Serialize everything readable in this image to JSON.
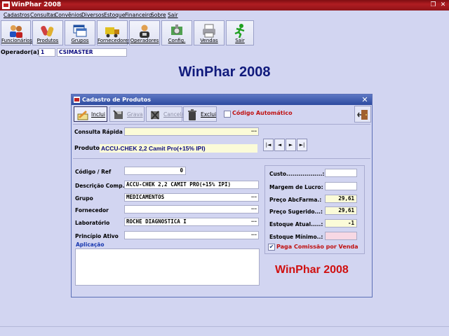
{
  "window": {
    "title": "WinPhar 2008"
  },
  "menu": [
    "Cadastros",
    "Consultas",
    "Convênios",
    "Diversos",
    "Estoque",
    "Financeiro",
    "Sobre",
    "Sair"
  ],
  "toolbar": [
    "Funcionários",
    "Produtos",
    "Grupos",
    "Fornecedores",
    "Operadores",
    "Config.",
    "Vendas",
    "Sair"
  ],
  "operator": {
    "label": "Operador(a):",
    "id": "1",
    "name": "CSIMASTER"
  },
  "heading": "WinPhar 2008",
  "dialog": {
    "title": "Cadastro de Produtos",
    "buttons": {
      "inclui": "Inclui",
      "grava": "Grava",
      "cancela": "Cancela",
      "exclui": "Exclui"
    },
    "auto_code_label": "Código Automático",
    "consulta_label": "Consulta Rápida",
    "consulta_value": "",
    "produto_label": "Produto",
    "produto_value": "ACCU-CHEK 2,2 Camit Pro(+15% IPI)",
    "nav": [
      "|◄",
      "◄",
      "►",
      "►|"
    ],
    "fields": {
      "codigo": {
        "label": "Código / Ref",
        "value": "0"
      },
      "descricao": {
        "label": "Descrição Comp.",
        "value": "ACCU-CHEK 2,2 CAMIT PRO(+15% IPI)"
      },
      "grupo": {
        "label": "Grupo",
        "value": "MEDICAMENTOS"
      },
      "fornecedor": {
        "label": "Fornecedor",
        "value": ""
      },
      "laboratorio": {
        "label": "Laboratório",
        "value": "ROCHE DIAGNOSTICA I"
      },
      "principio": {
        "label": "Princípio Ativo",
        "value": ""
      }
    },
    "aplicacao_label": "Aplicação",
    "aplicacao_value": "",
    "prices": {
      "custo": {
        "label": "Custo..................:",
        "value": ""
      },
      "margem": {
        "label": "Margem de Lucro:",
        "value": ""
      },
      "abc": {
        "label": "Preço AbcFarma.:",
        "value": "29,61"
      },
      "sugerido": {
        "label": "Preço Sugerido...:",
        "value": "29,61"
      },
      "estoque": {
        "label": "Estoque Atual.....:",
        "value": "-1"
      },
      "minimo": {
        "label": "Estoque Mínimo..:",
        "value": ""
      }
    },
    "paga_comissao_label": "Paga Comissão por Venda",
    "paga_comissao_checked": true,
    "brand": "WinPhar 2008"
  },
  "colors": {
    "title_red": "#b01d22",
    "dialog_blue": "#2d4a9f",
    "accent_red": "#d01010",
    "bg": "#d2d5f1"
  }
}
